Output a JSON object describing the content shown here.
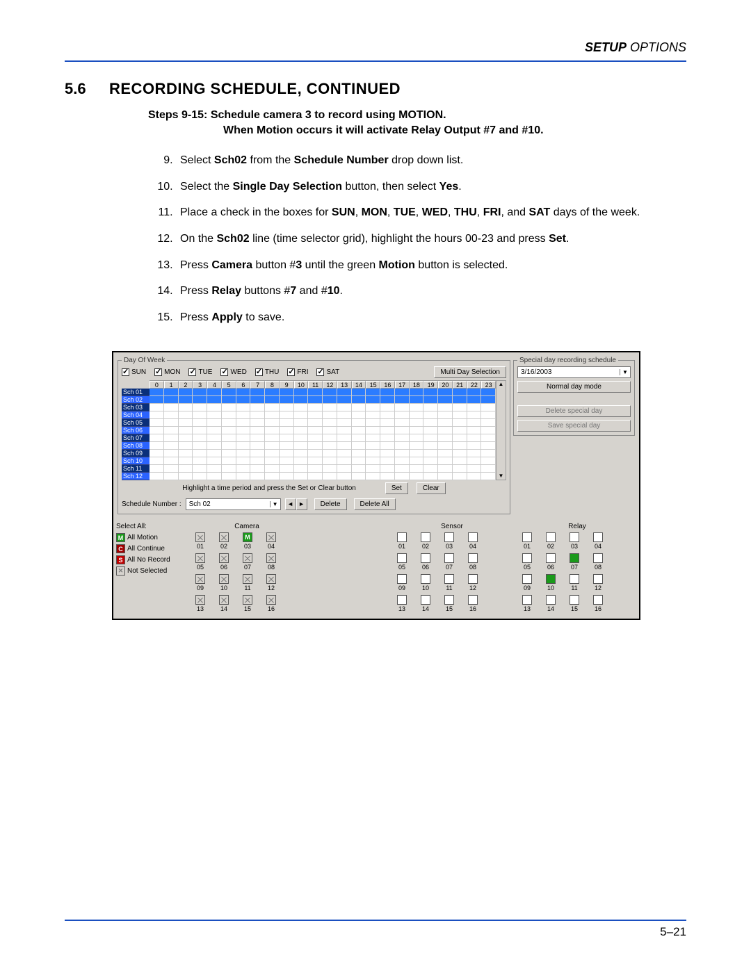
{
  "header": {
    "bold": "SETUP",
    "light": " OPTIONS"
  },
  "section": {
    "num": "5.6",
    "title": "RECORDING SCHEDULE, CONTINUED"
  },
  "stepsHeader": {
    "line1": "Steps 9-15:   Schedule camera 3 to record using MOTION.",
    "line2": "When Motion occurs it will activate Relay Output #7 and #10."
  },
  "steps": [
    {
      "pre": "Select ",
      "b1": "Sch02",
      "mid1": " from the ",
      "b2": "Schedule Number",
      "post": " drop down list."
    },
    {
      "pre": "Select the ",
      "b1": "Single Day Selection",
      "mid1": " button, then select ",
      "b2": "Yes",
      "post": "."
    },
    {
      "pre": "Place a check in the boxes for ",
      "b1": "SUN",
      "c1": ", ",
      "b2": "MON",
      "c2": ", ",
      "b3": "TUE",
      "c3": ", ",
      "b4": "WED",
      "c4": ", ",
      "b5": "THU",
      "c5": ", ",
      "b6": "FRI",
      "c6": ", and ",
      "b7": "SAT",
      "post": " days of the week."
    },
    {
      "pre": "On the ",
      "b1": "Sch02",
      "mid1": " line (time selector grid), highlight the hours 00-23 and press ",
      "b2": "Set",
      "post": "."
    },
    {
      "pre": "Press ",
      "b1": "Camera",
      "mid1": " button #",
      "b2": "3",
      "mid2": " until the green ",
      "b3": "Motion",
      "post": " button is selected."
    },
    {
      "pre": "Press ",
      "b1": "Relay",
      "mid1": " buttons #",
      "b2": "7",
      "mid2": " and #",
      "b3": "10",
      "post": "."
    },
    {
      "pre": "Press ",
      "b1": "Apply",
      "post": " to save."
    }
  ],
  "ui": {
    "dowLegend": "Day Of Week",
    "days": [
      "SUN",
      "MON",
      "TUE",
      "WED",
      "THU",
      "FRI",
      "SAT"
    ],
    "multiDay": "Multi Day Selection",
    "hours": [
      "0",
      "1",
      "2",
      "3",
      "4",
      "5",
      "6",
      "7",
      "8",
      "9",
      "10",
      "11",
      "12",
      "13",
      "14",
      "15",
      "16",
      "17",
      "18",
      "19",
      "20",
      "21",
      "22",
      "23"
    ],
    "schLabels": [
      "Sch 01",
      "Sch 02",
      "Sch 03",
      "Sch 04",
      "Sch 05",
      "Sch 06",
      "Sch 07",
      "Sch 08",
      "Sch 09",
      "Sch 10",
      "Sch 11",
      "Sch 12"
    ],
    "highlightHint": "Highlight a time period and press the Set or Clear button",
    "setBtn": "Set",
    "clearBtn": "Clear",
    "schedNumLabel": "Schedule Number :",
    "schedNumValue": "Sch 02",
    "deleteBtn": "Delete",
    "deleteAllBtn": "Delete All",
    "specialLegend": "Special day recording schedule",
    "specialDate": "3/16/2003",
    "normalDay": "Normal day mode",
    "deleteSpecial": "Delete special day",
    "saveSpecial": "Save special day",
    "selectAll": "Select All:",
    "cameraHdr": "Camera",
    "sensorHdr": "Sensor",
    "relayHdr": "Relay",
    "allMotion": "All Motion",
    "allContinue": "All Continue",
    "allNoRecord": "All No Record",
    "notSelected": "Not Selected",
    "nums": [
      "01",
      "02",
      "03",
      "04",
      "05",
      "06",
      "07",
      "08",
      "09",
      "10",
      "11",
      "12",
      "13",
      "14",
      "15",
      "16"
    ],
    "filledSchRows": [
      0,
      1
    ],
    "cameraMotionIdx": 2,
    "relayGreen": [
      6,
      9
    ]
  },
  "footer": {
    "page": "5–21"
  }
}
